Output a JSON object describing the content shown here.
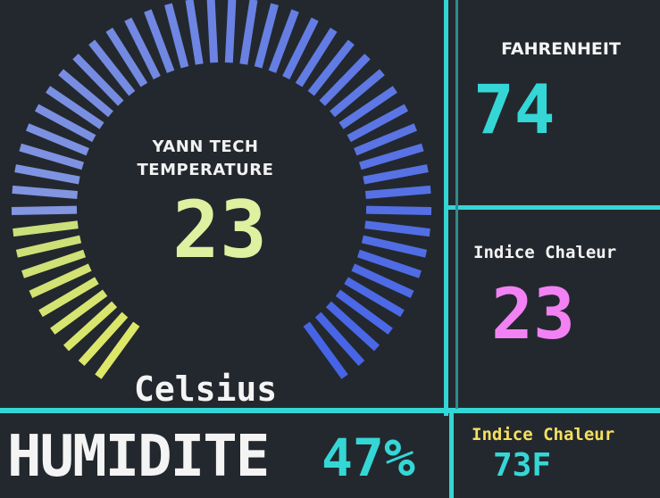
{
  "gauge": {
    "title_line1": "YANN TECH",
    "title_line2": "TEMPERATURE",
    "value": "23",
    "unit": "Celsius",
    "active_ticks": 20,
    "total_ticks": 50,
    "colors": {
      "cool": "#4a63e6",
      "warm": "#dde868",
      "muted": "#2a3170"
    }
  },
  "fahrenheit": {
    "label": "FAHRENHEIT",
    "value": "74",
    "color": "#34d7d6"
  },
  "heat_index_c": {
    "label": "Indice Chaleur",
    "value": "23",
    "color": "#f282f4"
  },
  "humidity": {
    "label": "HUMIDITE",
    "value": "47%",
    "color": "#34d7d6"
  },
  "heat_index_f": {
    "label": "Indice Chaleur",
    "value": "73F",
    "label_color": "#f4e060",
    "value_color": "#34d7d6"
  },
  "colors": {
    "divider": "#33d6d6",
    "text_main": "#f4f4f4",
    "temp_green": "#dff0a0"
  }
}
